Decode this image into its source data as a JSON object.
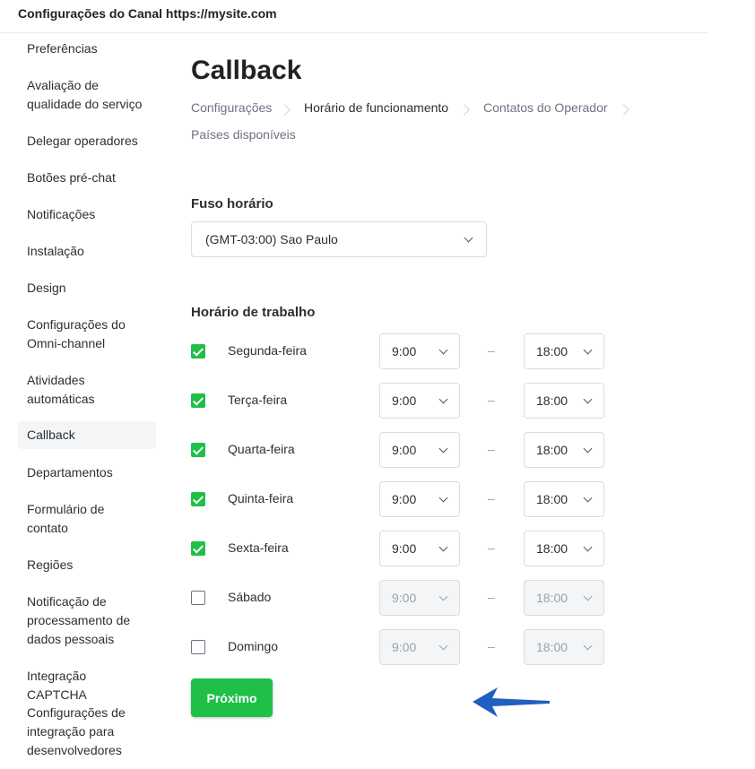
{
  "header": {
    "title": "Configurações do Canal https://mysite.com"
  },
  "sidebar": {
    "items": [
      {
        "id": "preferencias",
        "lines": [
          "Preferências"
        ],
        "active": false
      },
      {
        "id": "avaliacao",
        "lines": [
          "Avaliação de",
          "qualidade do serviço"
        ],
        "active": false
      },
      {
        "id": "delegar",
        "lines": [
          "Delegar operadores"
        ],
        "active": false
      },
      {
        "id": "botoes",
        "lines": [
          "Botões pré-chat"
        ],
        "active": false
      },
      {
        "id": "notificacoes",
        "lines": [
          "Notificações"
        ],
        "active": false
      },
      {
        "id": "instalacao",
        "lines": [
          "Instalação"
        ],
        "active": false
      },
      {
        "id": "design",
        "lines": [
          "Design"
        ],
        "active": false
      },
      {
        "id": "omnichannel",
        "lines": [
          "Configurações do",
          "Omni-channel"
        ],
        "active": false
      },
      {
        "id": "atividades",
        "lines": [
          "Atividades",
          "automáticas"
        ],
        "active": false
      },
      {
        "id": "callback",
        "lines": [
          "Callback"
        ],
        "active": true
      },
      {
        "id": "departamentos",
        "lines": [
          "Departamentos"
        ],
        "active": false
      },
      {
        "id": "formulario",
        "lines": [
          "Formulário de",
          "contato"
        ],
        "active": false
      },
      {
        "id": "regioes",
        "lines": [
          "Regiões"
        ],
        "active": false
      },
      {
        "id": "notificacao-dados",
        "lines": [
          "Notificação de",
          "processamento de",
          "dados pessoais"
        ],
        "active": false
      },
      {
        "id": "captcha",
        "lines": [
          "Integração CAPTCHA"
        ],
        "active": false
      },
      {
        "id": "integracao-dev",
        "lines": [
          "Configurações de",
          "integração para",
          "desenvolvedores"
        ],
        "active": false
      }
    ]
  },
  "page": {
    "title": "Callback",
    "breadcrumbs": [
      {
        "label": "Configurações",
        "active": false
      },
      {
        "label": "Horário de funcionamento",
        "active": true
      },
      {
        "label": "Contatos do Operador",
        "active": false
      },
      {
        "label": "Países disponíveis",
        "active": false
      }
    ],
    "timezone": {
      "label": "Fuso horário",
      "value": "(GMT-03:00) Sao Paulo"
    },
    "work_hours": {
      "label": "Horário de trabalho",
      "separator": "–",
      "days": [
        {
          "name": "Segunda-feira",
          "checked": true,
          "from": "9:00",
          "to": "18:00"
        },
        {
          "name": "Terça-feira",
          "checked": true,
          "from": "9:00",
          "to": "18:00"
        },
        {
          "name": "Quarta-feira",
          "checked": true,
          "from": "9:00",
          "to": "18:00"
        },
        {
          "name": "Quinta-feira",
          "checked": true,
          "from": "9:00",
          "to": "18:00"
        },
        {
          "name": "Sexta-feira",
          "checked": true,
          "from": "9:00",
          "to": "18:00"
        },
        {
          "name": "Sábado",
          "checked": false,
          "from": "9:00",
          "to": "18:00"
        },
        {
          "name": "Domingo",
          "checked": false,
          "from": "9:00",
          "to": "18:00"
        }
      ]
    },
    "next_button": {
      "label": "Próximo"
    }
  },
  "colors": {
    "accent": "#1fbf48",
    "arrow": "#1f5fbf"
  },
  "icons": {
    "arrow": "arrow-left-icon",
    "check": "check-icon",
    "caret": "chevron-down-icon"
  }
}
